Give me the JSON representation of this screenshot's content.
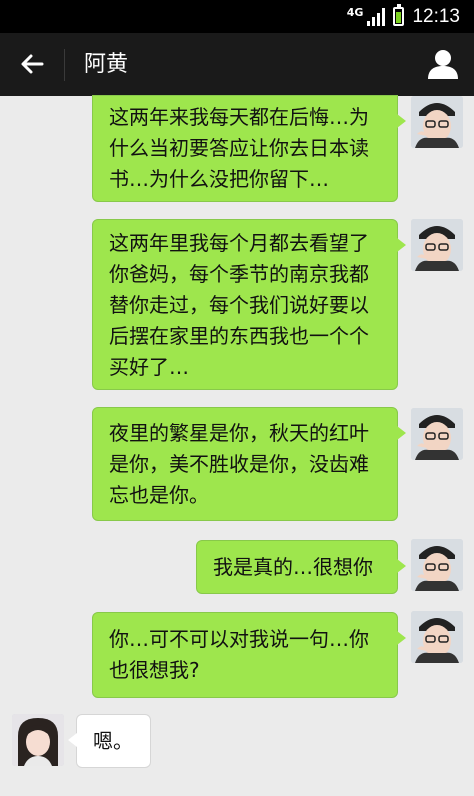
{
  "status_bar": {
    "network": "4G",
    "time": "12:13",
    "battery_color": "#7ed321"
  },
  "header": {
    "back_icon": "arrow-left-icon",
    "title": "阿黄",
    "profile_icon": "person-icon"
  },
  "messages": [
    {
      "side": "right",
      "lines": [
        "这两年来我每天都在后悔…为",
        "什么当初要答应让你去日本读",
        "书…为什么没把你留下…"
      ]
    },
    {
      "side": "right",
      "lines": [
        "这两年里我每个月都去看望了",
        "你爸妈，每个季节的南京我都",
        "替你走过，每个我们说好要以",
        "后摆在家里的东西我也一个个",
        "买好了…"
      ]
    },
    {
      "side": "right",
      "lines": [
        "夜里的繁星是你，秋天的红叶",
        "是你，美不胜收是你，没齿难",
        "忘也是你。"
      ]
    },
    {
      "side": "right",
      "lines": [
        "我是真的…很想你"
      ]
    },
    {
      "side": "right",
      "lines": [
        "你…可不可以对我说一句…你",
        "也很想我?"
      ]
    },
    {
      "side": "left",
      "lines": [
        "嗯。"
      ]
    }
  ],
  "colors": {
    "sent_bubble": "#9ee64d",
    "received_bubble": "#ffffff",
    "chat_background": "#ebebeb",
    "title_bar": "#1a1a1a"
  }
}
